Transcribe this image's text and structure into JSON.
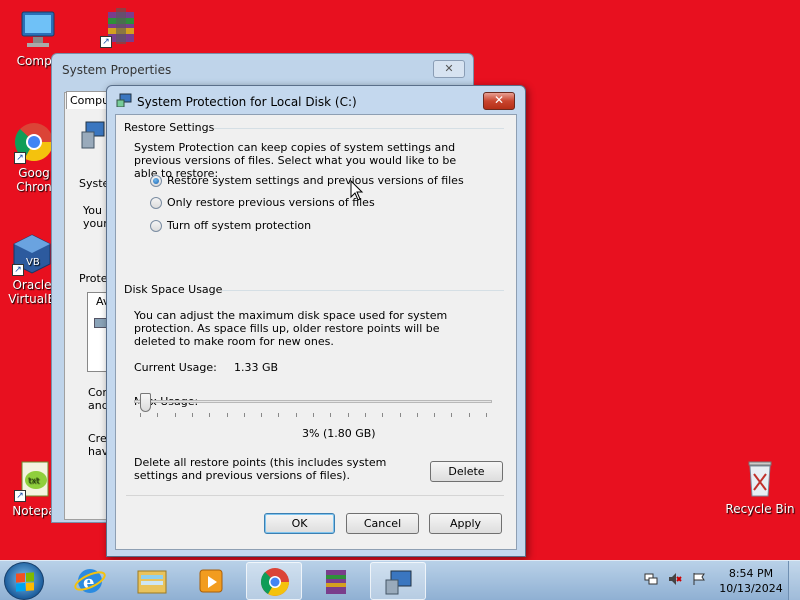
{
  "desktop": {
    "icons": [
      {
        "label": "Compu",
        "icon": "computer-icon"
      },
      {
        "label": "",
        "icon": "winrar-icon"
      },
      {
        "label": "Goog\nChron",
        "icon": "chrome-icon"
      },
      {
        "label": "Oracle\nVirtualB",
        "icon": "virtualbox-icon"
      },
      {
        "label": "Notepa",
        "icon": "notepad-icon"
      },
      {
        "label": "Recycle Bin",
        "icon": "recycle-bin-icon"
      }
    ]
  },
  "system_properties": {
    "title": "System Properties",
    "tab": "Comput",
    "fragments": [
      "Syster",
      "You c",
      "your",
      "Protec",
      "Av",
      "Con",
      "and",
      "Crea",
      "hav"
    ]
  },
  "dialog": {
    "title": "System Protection for Local Disk (C:)",
    "close_label": "✕",
    "restore_settings": {
      "heading": "Restore Settings",
      "description": "System Protection can keep copies of system settings and previous versions of files. Select what you would like to be able to restore:",
      "options": [
        {
          "label": "Restore system settings and previous versions of files",
          "selected": true
        },
        {
          "label": "Only restore previous versions of files",
          "selected": false
        },
        {
          "label": "Turn off system protection",
          "selected": false
        }
      ]
    },
    "disk_space": {
      "heading": "Disk Space Usage",
      "description": "You can adjust the maximum disk space used for system protection. As space fills up, older restore points will be deleted to make room for new ones.",
      "current_usage_label": "Current Usage:",
      "current_usage_value": "1.33 GB",
      "max_usage_label": "Max Usage:",
      "max_usage_percent": 3,
      "max_usage_readout": "3% (1.80 GB)",
      "delete_description": "Delete all restore points (this includes system settings and previous versions of files).",
      "delete_label": "Delete"
    },
    "buttons": {
      "ok": "OK",
      "cancel": "Cancel",
      "apply": "Apply"
    }
  },
  "taskbar": {
    "items": [
      "start-button",
      "internet-explorer-icon",
      "file-explorer-icon",
      "media-player-icon",
      "chrome-icon",
      "winrar-icon",
      "system-properties-icon"
    ],
    "time": "8:54 PM",
    "date": "10/13/2024"
  }
}
